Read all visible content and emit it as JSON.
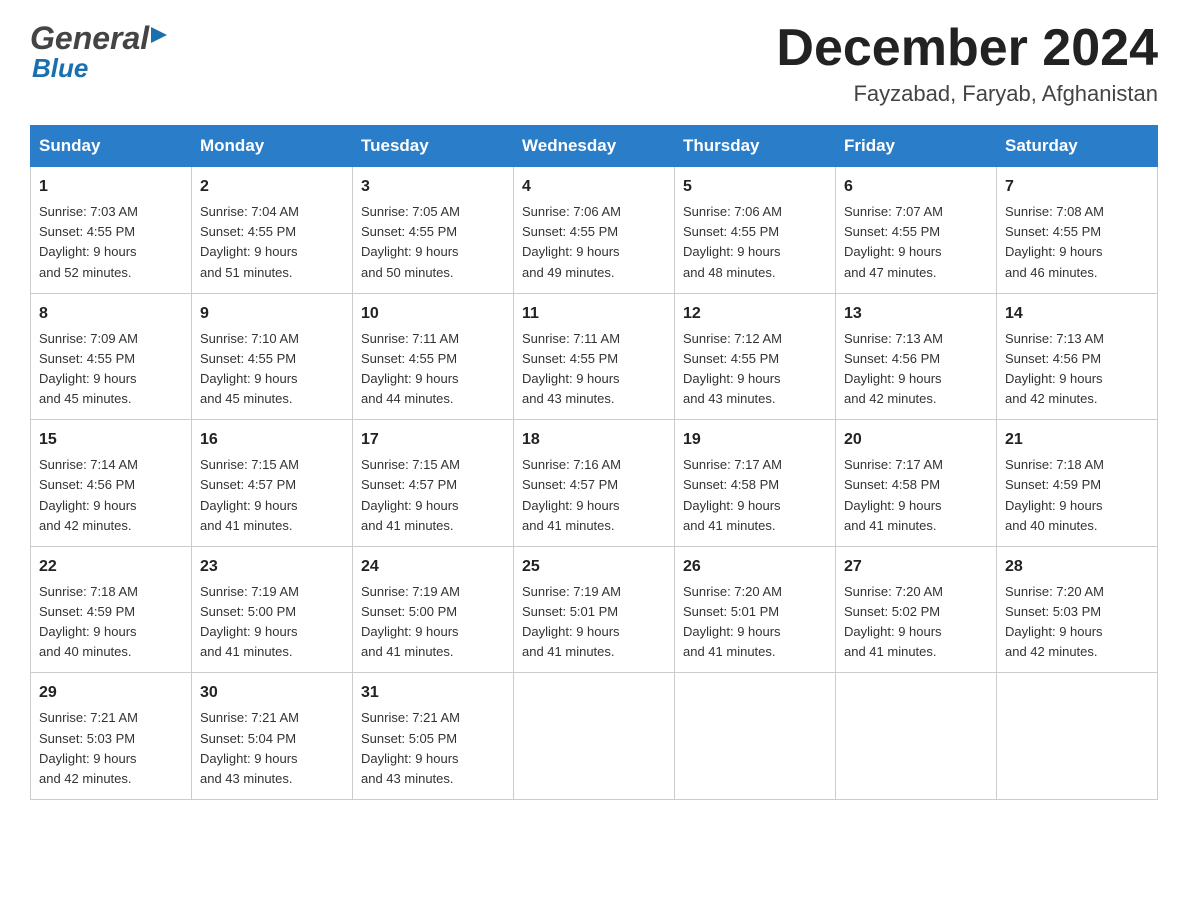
{
  "header": {
    "logo_general": "General",
    "logo_blue": "Blue",
    "month_title": "December 2024",
    "location": "Fayzabad, Faryab, Afghanistan"
  },
  "days_of_week": [
    "Sunday",
    "Monday",
    "Tuesday",
    "Wednesday",
    "Thursday",
    "Friday",
    "Saturday"
  ],
  "weeks": [
    [
      {
        "day": "1",
        "sunrise": "7:03 AM",
        "sunset": "4:55 PM",
        "daylight": "9 hours and 52 minutes."
      },
      {
        "day": "2",
        "sunrise": "7:04 AM",
        "sunset": "4:55 PM",
        "daylight": "9 hours and 51 minutes."
      },
      {
        "day": "3",
        "sunrise": "7:05 AM",
        "sunset": "4:55 PM",
        "daylight": "9 hours and 50 minutes."
      },
      {
        "day": "4",
        "sunrise": "7:06 AM",
        "sunset": "4:55 PM",
        "daylight": "9 hours and 49 minutes."
      },
      {
        "day": "5",
        "sunrise": "7:06 AM",
        "sunset": "4:55 PM",
        "daylight": "9 hours and 48 minutes."
      },
      {
        "day": "6",
        "sunrise": "7:07 AM",
        "sunset": "4:55 PM",
        "daylight": "9 hours and 47 minutes."
      },
      {
        "day": "7",
        "sunrise": "7:08 AM",
        "sunset": "4:55 PM",
        "daylight": "9 hours and 46 minutes."
      }
    ],
    [
      {
        "day": "8",
        "sunrise": "7:09 AM",
        "sunset": "4:55 PM",
        "daylight": "9 hours and 45 minutes."
      },
      {
        "day": "9",
        "sunrise": "7:10 AM",
        "sunset": "4:55 PM",
        "daylight": "9 hours and 45 minutes."
      },
      {
        "day": "10",
        "sunrise": "7:11 AM",
        "sunset": "4:55 PM",
        "daylight": "9 hours and 44 minutes."
      },
      {
        "day": "11",
        "sunrise": "7:11 AM",
        "sunset": "4:55 PM",
        "daylight": "9 hours and 43 minutes."
      },
      {
        "day": "12",
        "sunrise": "7:12 AM",
        "sunset": "4:55 PM",
        "daylight": "9 hours and 43 minutes."
      },
      {
        "day": "13",
        "sunrise": "7:13 AM",
        "sunset": "4:56 PM",
        "daylight": "9 hours and 42 minutes."
      },
      {
        "day": "14",
        "sunrise": "7:13 AM",
        "sunset": "4:56 PM",
        "daylight": "9 hours and 42 minutes."
      }
    ],
    [
      {
        "day": "15",
        "sunrise": "7:14 AM",
        "sunset": "4:56 PM",
        "daylight": "9 hours and 42 minutes."
      },
      {
        "day": "16",
        "sunrise": "7:15 AM",
        "sunset": "4:57 PM",
        "daylight": "9 hours and 41 minutes."
      },
      {
        "day": "17",
        "sunrise": "7:15 AM",
        "sunset": "4:57 PM",
        "daylight": "9 hours and 41 minutes."
      },
      {
        "day": "18",
        "sunrise": "7:16 AM",
        "sunset": "4:57 PM",
        "daylight": "9 hours and 41 minutes."
      },
      {
        "day": "19",
        "sunrise": "7:17 AM",
        "sunset": "4:58 PM",
        "daylight": "9 hours and 41 minutes."
      },
      {
        "day": "20",
        "sunrise": "7:17 AM",
        "sunset": "4:58 PM",
        "daylight": "9 hours and 41 minutes."
      },
      {
        "day": "21",
        "sunrise": "7:18 AM",
        "sunset": "4:59 PM",
        "daylight": "9 hours and 40 minutes."
      }
    ],
    [
      {
        "day": "22",
        "sunrise": "7:18 AM",
        "sunset": "4:59 PM",
        "daylight": "9 hours and 40 minutes."
      },
      {
        "day": "23",
        "sunrise": "7:19 AM",
        "sunset": "5:00 PM",
        "daylight": "9 hours and 41 minutes."
      },
      {
        "day": "24",
        "sunrise": "7:19 AM",
        "sunset": "5:00 PM",
        "daylight": "9 hours and 41 minutes."
      },
      {
        "day": "25",
        "sunrise": "7:19 AM",
        "sunset": "5:01 PM",
        "daylight": "9 hours and 41 minutes."
      },
      {
        "day": "26",
        "sunrise": "7:20 AM",
        "sunset": "5:01 PM",
        "daylight": "9 hours and 41 minutes."
      },
      {
        "day": "27",
        "sunrise": "7:20 AM",
        "sunset": "5:02 PM",
        "daylight": "9 hours and 41 minutes."
      },
      {
        "day": "28",
        "sunrise": "7:20 AM",
        "sunset": "5:03 PM",
        "daylight": "9 hours and 42 minutes."
      }
    ],
    [
      {
        "day": "29",
        "sunrise": "7:21 AM",
        "sunset": "5:03 PM",
        "daylight": "9 hours and 42 minutes."
      },
      {
        "day": "30",
        "sunrise": "7:21 AM",
        "sunset": "5:04 PM",
        "daylight": "9 hours and 43 minutes."
      },
      {
        "day": "31",
        "sunrise": "7:21 AM",
        "sunset": "5:05 PM",
        "daylight": "9 hours and 43 minutes."
      },
      null,
      null,
      null,
      null
    ]
  ],
  "labels": {
    "sunrise": "Sunrise:",
    "sunset": "Sunset:",
    "daylight": "Daylight:"
  },
  "colors": {
    "header_bg": "#2a7dc9",
    "accent_blue": "#1a6faf"
  }
}
